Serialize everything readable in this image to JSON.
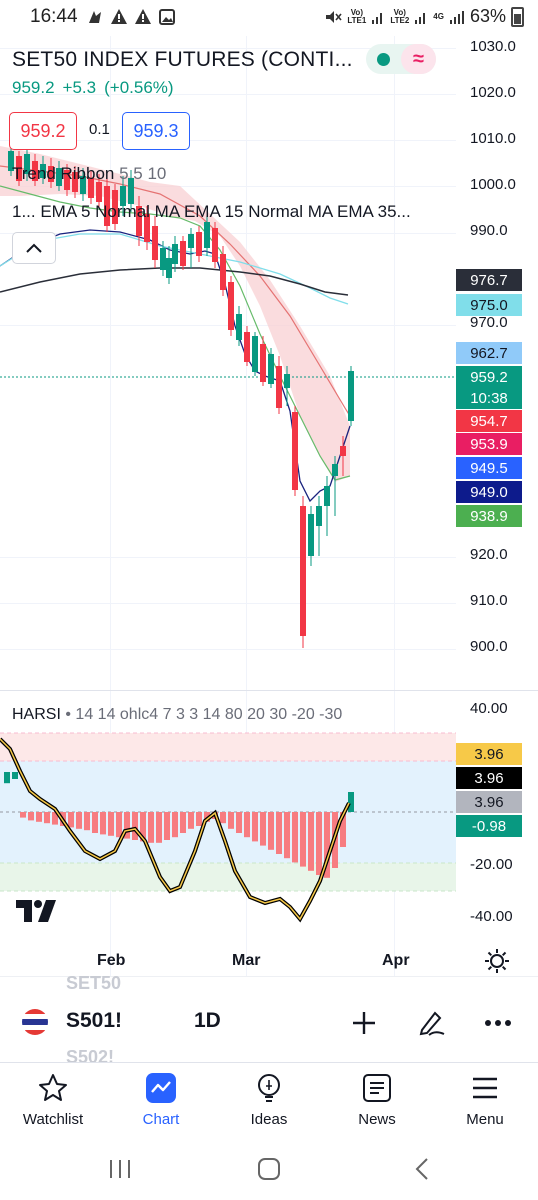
{
  "status": {
    "time": "16:44",
    "net_1": "Vo)\nLTE1",
    "net_2": "Vo)\nLTE2",
    "net_type": "4G",
    "battery": "63%"
  },
  "header": {
    "symbol_title": "SET50 INDEX FUTURES (CONTI...",
    "last_price": "959.2",
    "change": "+5.3",
    "change_pct": "(+0.56%)"
  },
  "quote": {
    "sell": "959.2",
    "spread": "0.1",
    "buy": "959.3"
  },
  "indicators": {
    "ribbon_name": "Trend Ribbon",
    "ribbon_params": "5 5 10",
    "ma_line": "1... EMA 5 Normal MA EMA 15 Normal MA EMA 35...",
    "harsi_name": "HARSI",
    "harsi_params": "14 14 ohlc4 7 3 3 14 80 20 30 -20 -30"
  },
  "price_axis": {
    "labels": [
      "1030.0",
      "1020.0",
      "1010.0",
      "1000.0",
      "990.0",
      "970.0",
      "920.0",
      "910.0",
      "900.0"
    ],
    "tags": [
      {
        "text": "976.7",
        "color": "#2a2e39"
      },
      {
        "text": "975.0",
        "color": "#80deea"
      },
      {
        "text": "962.7",
        "color": "#90caf9"
      },
      {
        "text": "959.2",
        "color": "#089981"
      },
      {
        "text": "10:38",
        "color": "#089981"
      },
      {
        "text": "954.7",
        "color": "#f23645"
      },
      {
        "text": "953.9",
        "color": "#e91e63"
      },
      {
        "text": "949.5",
        "color": "#2962ff"
      },
      {
        "text": "949.0",
        "color": "#0d1b8c"
      },
      {
        "text": "938.9",
        "color": "#4caf50"
      }
    ]
  },
  "harsi_axis": {
    "labels": [
      "40.00",
      "-20.00",
      "-40.00"
    ],
    "tags": [
      {
        "text": "3.96",
        "color": "#f7c948"
      },
      {
        "text": "3.96",
        "color": "#000000"
      },
      {
        "text": "3.96",
        "color": "#b2b5be"
      },
      {
        "text": "-0.98",
        "color": "#089981"
      }
    ]
  },
  "time_axis": {
    "labels": [
      "Feb",
      "Mar",
      "Apr"
    ]
  },
  "symbol_bar": {
    "ghost_prev": "SET50",
    "symbol": "S501!",
    "ghost_next": "S502!",
    "interval": "1D"
  },
  "nav": {
    "items": [
      {
        "label": "Watchlist",
        "icon": "star-icon"
      },
      {
        "label": "Chart",
        "icon": "chart-icon"
      },
      {
        "label": "Ideas",
        "icon": "lightbulb-icon"
      },
      {
        "label": "News",
        "icon": "news-icon"
      },
      {
        "label": "Menu",
        "icon": "menu-icon"
      }
    ],
    "active": "Chart"
  },
  "colors": {
    "up": "#089981",
    "down": "#f23645",
    "accent": "#2962ff"
  }
}
